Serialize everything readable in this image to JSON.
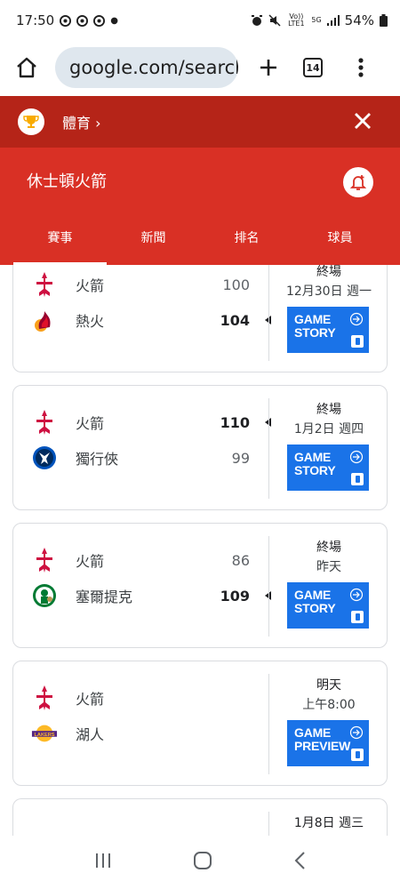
{
  "status_bar": {
    "time": "17:50",
    "battery": "54%",
    "network_volte": "Vo)) LTE1",
    "network_5g": "5G"
  },
  "browser": {
    "url": "google.com/search",
    "tab_count": "14"
  },
  "sports_header": {
    "label": "體育 ›"
  },
  "team": {
    "title": "休士頓火箭",
    "tabs": [
      "賽事",
      "新聞",
      "排名",
      "球員"
    ],
    "active_tab": 0
  },
  "games": [
    {
      "home": {
        "name": "火箭",
        "score": "100",
        "logo": "rockets-logo",
        "winner": false
      },
      "away": {
        "name": "熱火",
        "score": "104",
        "logo": "heat-logo",
        "winner": true
      },
      "status": "終場",
      "date": "12月30日 週一",
      "button": {
        "line1": "GAME",
        "line2": "STORY"
      }
    },
    {
      "home": {
        "name": "火箭",
        "score": "110",
        "logo": "rockets-logo",
        "winner": true
      },
      "away": {
        "name": "獨行俠",
        "score": "99",
        "logo": "mavericks-logo",
        "winner": false
      },
      "status": "終場",
      "date": "1月2日 週四",
      "button": {
        "line1": "GAME",
        "line2": "STORY"
      }
    },
    {
      "home": {
        "name": "火箭",
        "score": "86",
        "logo": "rockets-logo",
        "winner": false
      },
      "away": {
        "name": "塞爾提克",
        "score": "109",
        "logo": "celtics-logo",
        "winner": true
      },
      "status": "終場",
      "date": "昨天",
      "button": {
        "line1": "GAME",
        "line2": "STORY"
      }
    },
    {
      "home": {
        "name": "火箭",
        "score": "",
        "logo": "rockets-logo",
        "winner": false
      },
      "away": {
        "name": "湖人",
        "score": "",
        "logo": "lakers-logo",
        "winner": false
      },
      "status": "明天",
      "date": "上午8:00",
      "button": {
        "line1": "GAME",
        "line2": "PREVIEW"
      }
    }
  ],
  "partial_game": {
    "date": "1月8日 週三"
  },
  "colors": {
    "sports_bar": "#b52418",
    "team_header": "#d93025",
    "button_blue": "#1a73e8"
  }
}
